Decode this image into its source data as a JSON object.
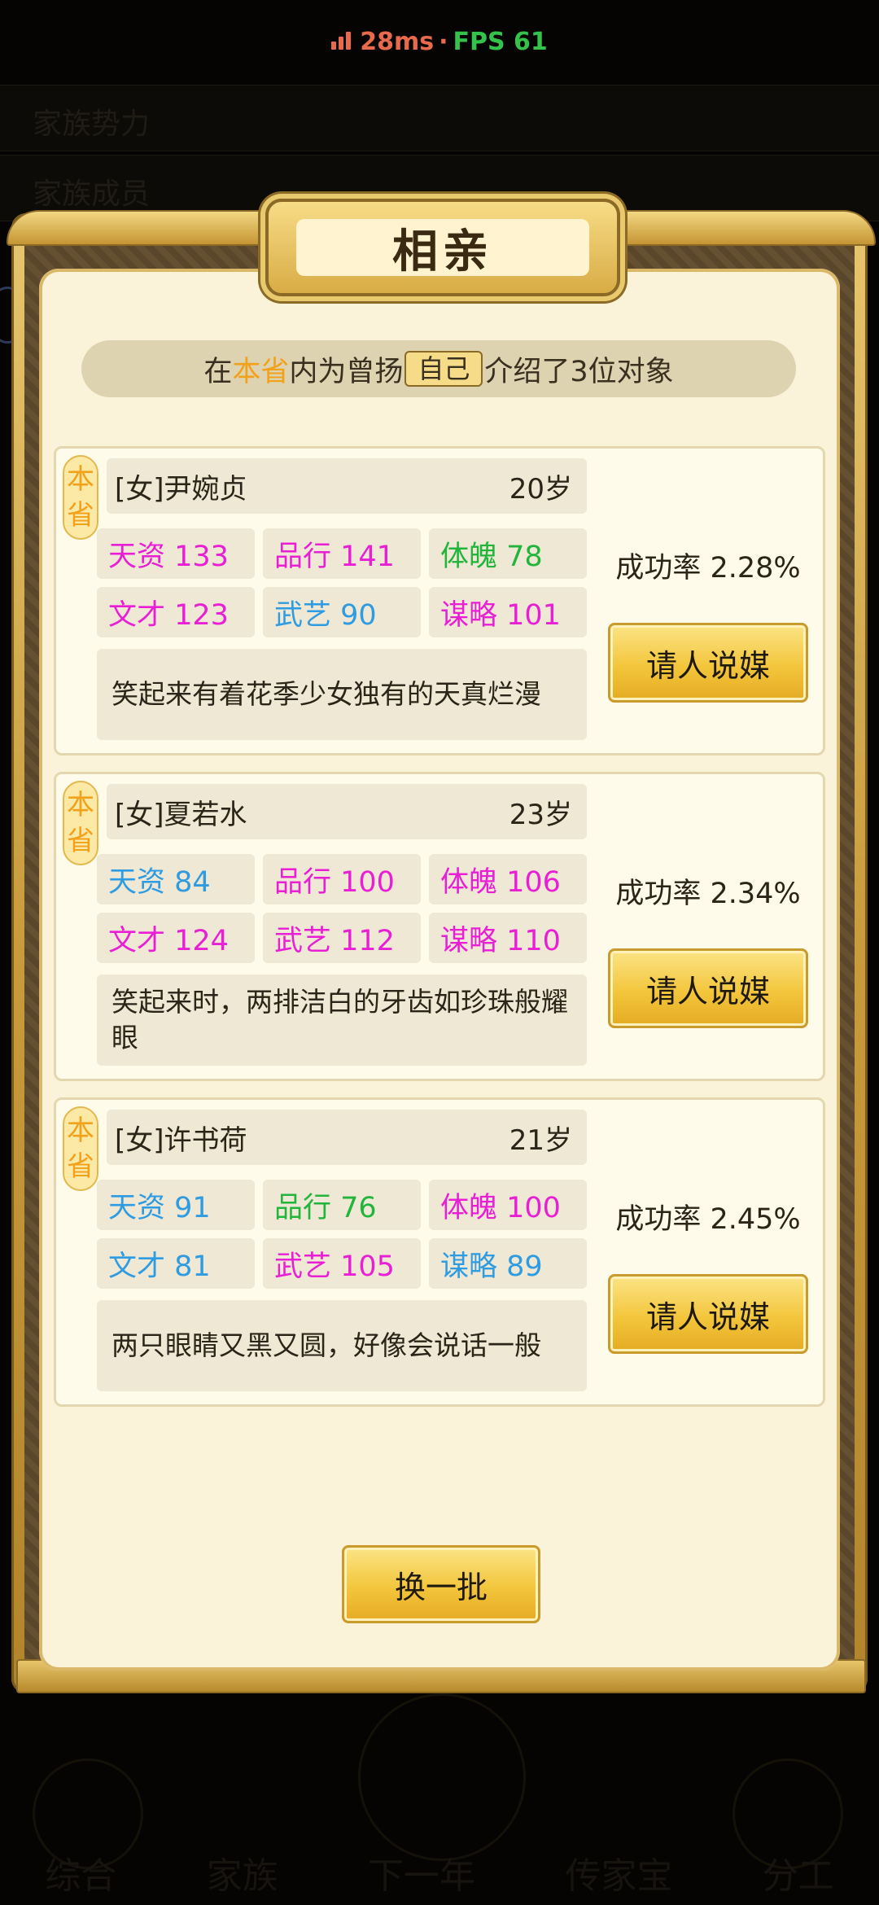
{
  "overlay": {
    "ping": "28ms",
    "separator": "·",
    "fps": "FPS 61"
  },
  "modal": {
    "title": "相亲",
    "subtitle": {
      "pre": "在",
      "scope": "本省",
      "mid": "内为曾扬",
      "self": "自己",
      "post": "介绍了3位对象"
    },
    "refresh_label": "换一批"
  },
  "candidates": [
    {
      "badge": "本省",
      "name": "[女]尹婉贞",
      "age": "20岁",
      "stats": [
        {
          "text": "天资 133",
          "color": "#e81fd4"
        },
        {
          "text": "品行 141",
          "color": "#e81fd4"
        },
        {
          "text": "体魄 78",
          "color": "#22b53b"
        },
        {
          "text": "文才 123",
          "color": "#e81fd4"
        },
        {
          "text": "武艺 90",
          "color": "#2f9be0"
        },
        {
          "text": "谋略 101",
          "color": "#e81fd4"
        }
      ],
      "description": "笑起来有着花季少女独有的天真烂漫",
      "success_rate": "成功率 2.28%",
      "action_label": "请人说媒"
    },
    {
      "badge": "本省",
      "name": "[女]夏若水",
      "age": "23岁",
      "stats": [
        {
          "text": "天资 84",
          "color": "#2f9be0"
        },
        {
          "text": "品行 100",
          "color": "#e81fd4"
        },
        {
          "text": "体魄 106",
          "color": "#e81fd4"
        },
        {
          "text": "文才 124",
          "color": "#e81fd4"
        },
        {
          "text": "武艺 112",
          "color": "#e81fd4"
        },
        {
          "text": "谋略 110",
          "color": "#e81fd4"
        }
      ],
      "description": "笑起来时，两排洁白的牙齿如珍珠般耀眼",
      "success_rate": "成功率 2.34%",
      "action_label": "请人说媒"
    },
    {
      "badge": "本省",
      "name": "[女]许书荷",
      "age": "21岁",
      "stats": [
        {
          "text": "天资 91",
          "color": "#2f9be0"
        },
        {
          "text": "品行 76",
          "color": "#22b53b"
        },
        {
          "text": "体魄 100",
          "color": "#e81fd4"
        },
        {
          "text": "文才 81",
          "color": "#2f9be0"
        },
        {
          "text": "武艺 105",
          "color": "#e81fd4"
        },
        {
          "text": "谋略 89",
          "color": "#2f9be0"
        }
      ],
      "description": "两只眼睛又黑又圆，好像会说话一般",
      "success_rate": "成功率 2.45%",
      "action_label": "请人说媒"
    }
  ],
  "background": {
    "top_row_1": "家族势力",
    "top_row_2": "家族成员",
    "nav": [
      "综合",
      "家族",
      "下一年",
      "传家宝",
      "分工"
    ]
  }
}
